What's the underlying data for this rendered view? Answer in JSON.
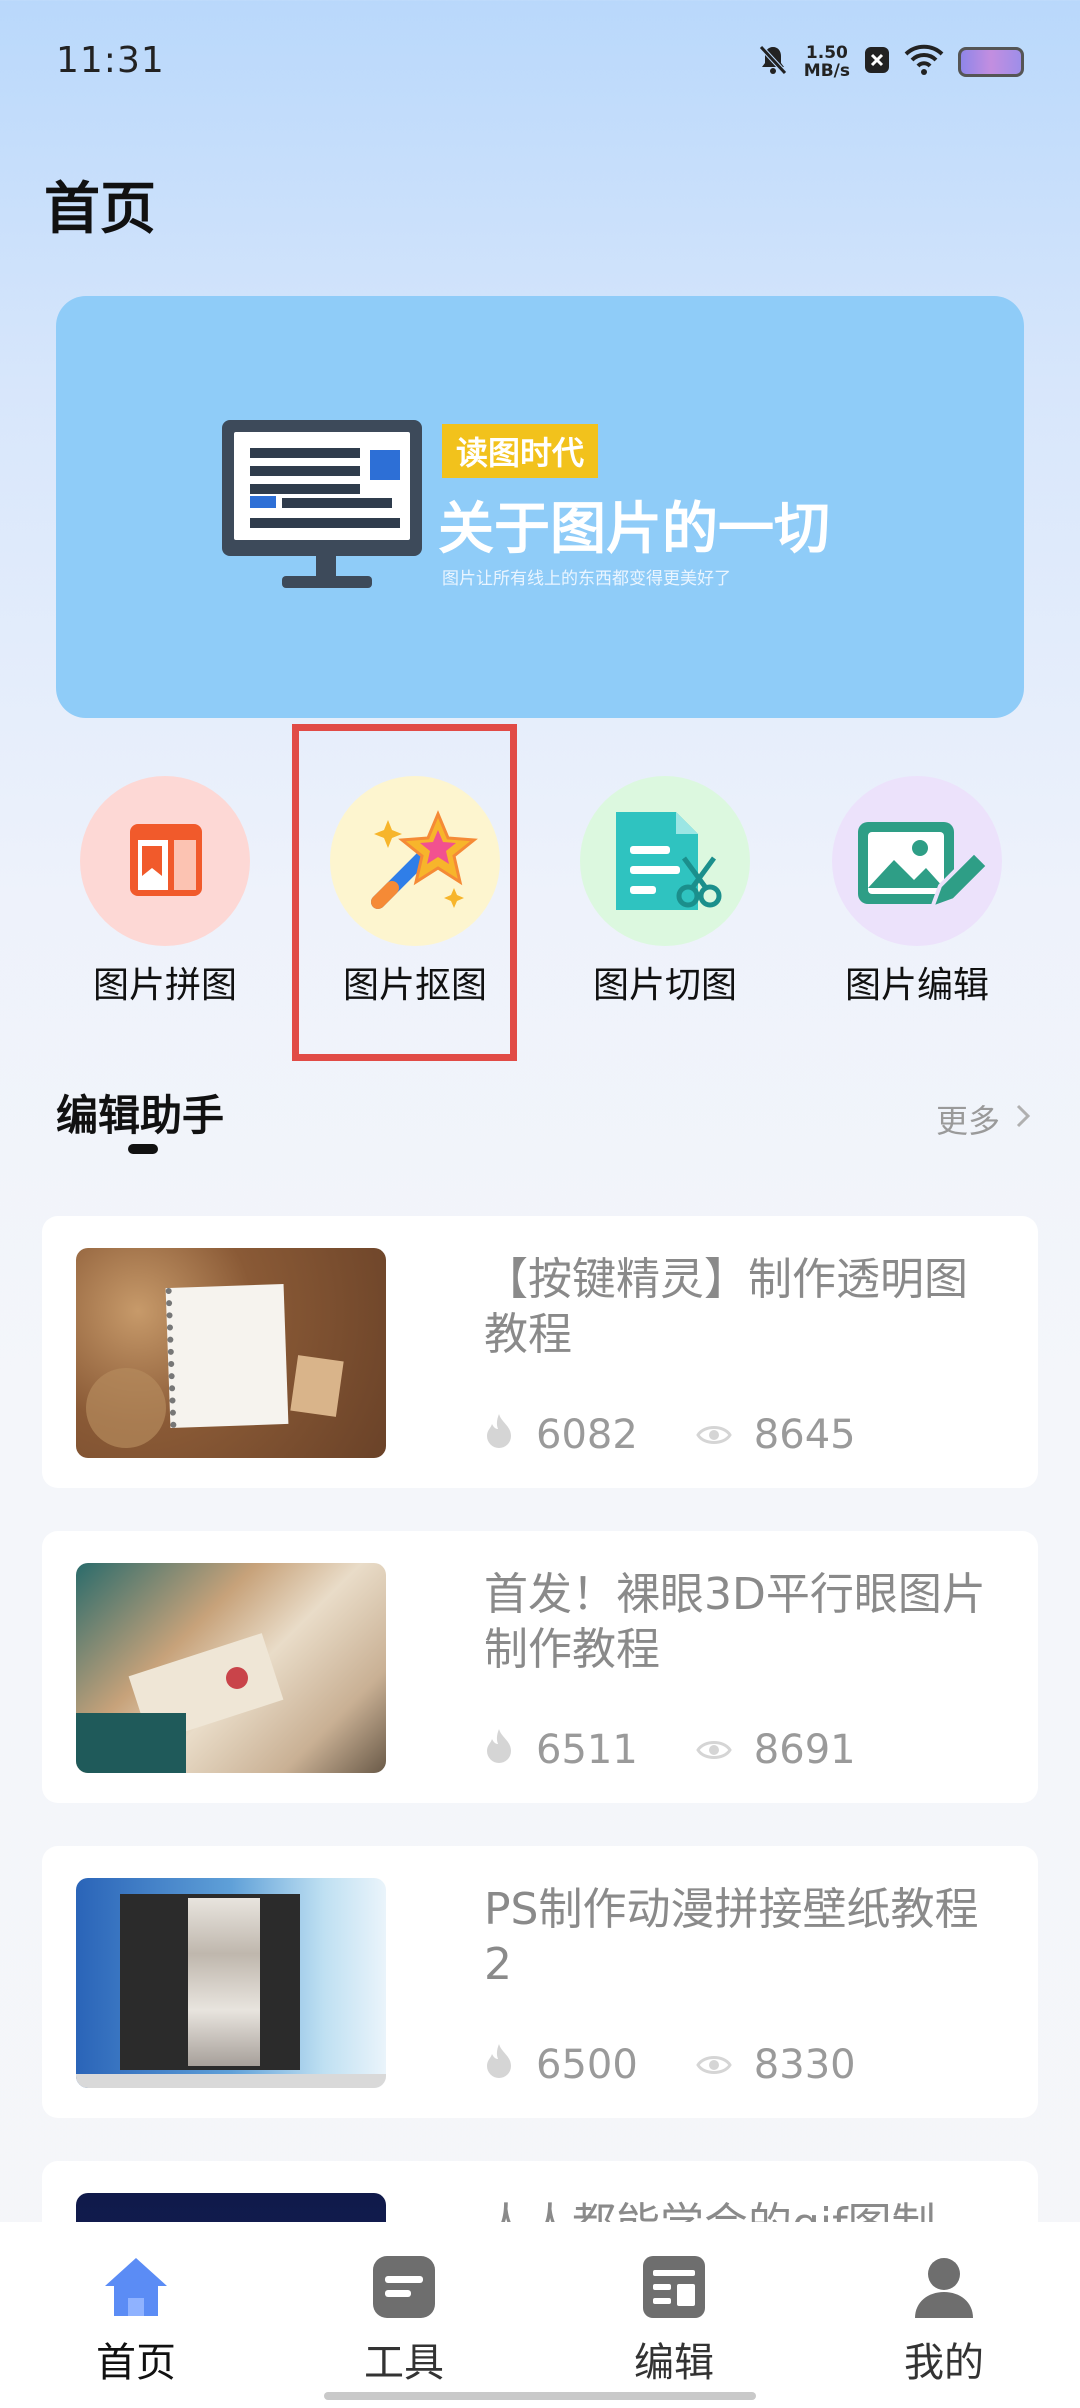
{
  "status_bar": {
    "time": "11:31",
    "speed_value": "1.50",
    "speed_unit": "MB/s",
    "icons": [
      "bell-off-icon",
      "close-box-icon",
      "wifi-icon",
      "battery-icon"
    ]
  },
  "page": {
    "title": "首页"
  },
  "banner": {
    "tag": "读图时代",
    "title": "关于图片的一切",
    "subtitle": "图片让所有线上的东西都变得更美好了",
    "background_color": "#8fccf8"
  },
  "quick_actions": [
    {
      "label": "图片拼图",
      "icon": "collage-icon",
      "bg": "#fdd8d5"
    },
    {
      "label": "图片抠图",
      "icon": "magic-wand-icon",
      "bg": "#fdf5cf",
      "highlighted": true
    },
    {
      "label": "图片切图",
      "icon": "file-cut-icon",
      "bg": "#dcf8df"
    },
    {
      "label": "图片编辑",
      "icon": "image-edit-icon",
      "bg": "#ece2fb"
    }
  ],
  "section": {
    "title": "编辑助手",
    "more_label": "更多"
  },
  "articles": [
    {
      "title": "【按键精灵】制作透明图教程",
      "likes": "6082",
      "views": "8645"
    },
    {
      "title": "首发！裸眼3D平行眼图片制作教程",
      "likes": "6511",
      "views": "8691"
    },
    {
      "title": "PS制作动漫拼接壁纸教程2",
      "likes": "6500",
      "views": "8330"
    },
    {
      "title": "人人都能学会的gif图制",
      "likes": "",
      "views": ""
    }
  ],
  "bottom_nav": [
    {
      "label": "首页",
      "icon": "home-icon",
      "active": true
    },
    {
      "label": "工具",
      "icon": "tools-icon",
      "active": false
    },
    {
      "label": "编辑",
      "icon": "edit-icon",
      "active": false
    },
    {
      "label": "我的",
      "icon": "profile-icon",
      "active": false
    }
  ],
  "colors": {
    "highlight_border": "#e14b46",
    "nav_active": "#5b8cf5",
    "nav_inactive": "#6e6e6e"
  }
}
